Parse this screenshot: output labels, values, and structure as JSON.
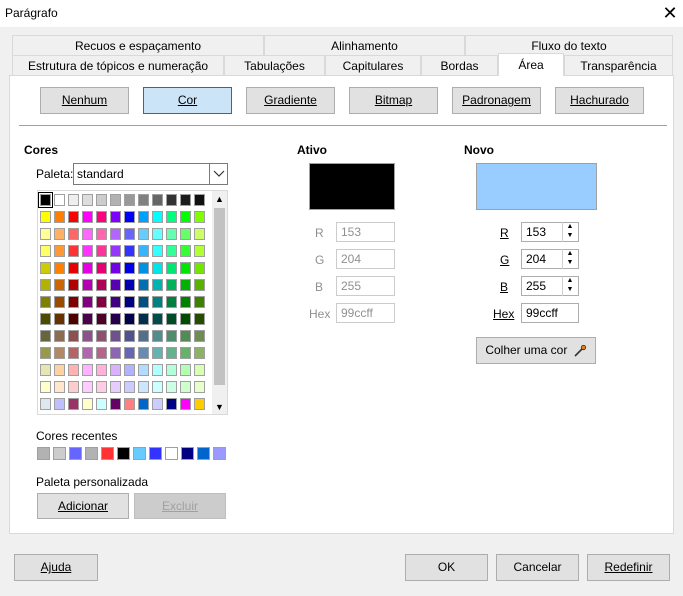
{
  "window": {
    "title": "Parágrafo"
  },
  "tabs_row1": [
    "Recuos e espaçamento",
    "Alinhamento",
    "Fluxo do texto"
  ],
  "tabs_row2": [
    "Estrutura de tópicos e numeração",
    "Tabulações",
    "Capitulares",
    "Bordas",
    "Área",
    "Transparência"
  ],
  "fill_buttons": [
    "Nenhum",
    "Cor",
    "Gradiente",
    "Bitmap",
    "Padronagem",
    "Hachurado"
  ],
  "colors": {
    "heading": "Cores",
    "palette_label": "Paleta:",
    "palette_value": "standard",
    "recent_label": "Cores recentes",
    "custom_label": "Paleta personalizada",
    "add_button": "Adicionar",
    "delete_button": "Excluir"
  },
  "active": {
    "heading": "Ativo",
    "color": "#000000",
    "r_label": "R",
    "g_label": "G",
    "b_label": "B",
    "hex_label": "Hex",
    "r": "153",
    "g": "204",
    "b": "255",
    "hex": "99ccff"
  },
  "new": {
    "heading": "Novo",
    "color": "#99ccff",
    "r_label": "R",
    "g_label": "G",
    "b_label": "B",
    "hex_label": "Hex",
    "r": "153",
    "g": "204",
    "b": "255",
    "hex": "99ccff",
    "pick_button": "Colher uma cor"
  },
  "footer": {
    "help": "Ajuda",
    "ok": "OK",
    "cancel": "Cancelar",
    "reset": "Redefinir"
  },
  "palette_rows": [
    [
      "#000000",
      "#ffffff",
      "#eeeeee",
      "#dddddd",
      "#cccccc",
      "#b2b2b2",
      "#999999",
      "#808080",
      "#666666",
      "#333333",
      "#1c1c1c",
      "#111111"
    ],
    [
      "#ffff00",
      "#ff8000",
      "#ff0000",
      "#ff00ff",
      "#ff0080",
      "#8000ff",
      "#0000ff",
      "#00a0ff",
      "#00ffff",
      "#00ff80",
      "#00ff00",
      "#80ff00"
    ],
    [
      "#ffff99",
      "#ffb266",
      "#ff6666",
      "#ff66ff",
      "#ff66b2",
      "#b266ff",
      "#6666ff",
      "#66ccff",
      "#66ffff",
      "#66ffb2",
      "#66ff66",
      "#ccff66"
    ],
    [
      "#ffff66",
      "#ff9933",
      "#ff3333",
      "#ff33ff",
      "#ff3399",
      "#9933ff",
      "#3333ff",
      "#33b5ff",
      "#33ffff",
      "#33ff99",
      "#33ff33",
      "#b2ff33"
    ],
    [
      "#cccc00",
      "#ff7f00",
      "#e60000",
      "#e600e6",
      "#e60073",
      "#7300e6",
      "#0000e6",
      "#0090e6",
      "#00e6e6",
      "#00e673",
      "#00e600",
      "#73e600"
    ],
    [
      "#b2b200",
      "#cc6600",
      "#b20000",
      "#b200b2",
      "#b20059",
      "#5900b2",
      "#0000b2",
      "#0070b2",
      "#00b2b2",
      "#00b259",
      "#00b200",
      "#59b200"
    ],
    [
      "#808000",
      "#994c00",
      "#800000",
      "#800080",
      "#800040",
      "#400080",
      "#000080",
      "#005080",
      "#008080",
      "#008040",
      "#008000",
      "#408000"
    ],
    [
      "#4c4c00",
      "#663300",
      "#4c0000",
      "#4c004c",
      "#4c0026",
      "#26004c",
      "#00004c",
      "#00304c",
      "#004c4c",
      "#004c26",
      "#004c00",
      "#264c00"
    ],
    [
      "#66663d",
      "#8c6d52",
      "#8c5252",
      "#8c528c",
      "#8c526f",
      "#6f528c",
      "#52528c",
      "#52708c",
      "#528c8c",
      "#528c6f",
      "#528c52",
      "#6f8c52"
    ],
    [
      "#99994d",
      "#b28a66",
      "#b26666",
      "#b266b2",
      "#b2668c",
      "#8c66b2",
      "#6666b2",
      "#668cb2",
      "#66b2b2",
      "#66b28c",
      "#66b266",
      "#8cb266"
    ],
    [
      "#e6e6b2",
      "#ffd2a6",
      "#ffb2b2",
      "#ffb2ff",
      "#ffb2d9",
      "#d9b2ff",
      "#b2b2ff",
      "#b2dcff",
      "#b2ffff",
      "#b2ffd9",
      "#b2ffb2",
      "#d9ffb2"
    ],
    [
      "#ffffcc",
      "#ffe6cc",
      "#ffcccc",
      "#ffccff",
      "#ffcce6",
      "#e6ccff",
      "#ccccff",
      "#cce6ff",
      "#ccffff",
      "#ccffe6",
      "#ccffcc",
      "#e6ffcc"
    ],
    [
      "#dee6ef",
      "#c0c0ff",
      "#993366",
      "#ffffcc",
      "#ccffff",
      "#660066",
      "#ff8080",
      "#0066cc",
      "#ccccff",
      "#000080",
      "#ff00ff",
      "#ffcc00"
    ]
  ],
  "recent_colors": [
    "#b2b2b2",
    "#cccccc",
    "#6666ff",
    "#b2b2b2",
    "#ff3333",
    "#000000",
    "#66ccff",
    "#3333ff",
    "#ffffff",
    "#000080",
    "#0066cc",
    "#9999ff"
  ]
}
